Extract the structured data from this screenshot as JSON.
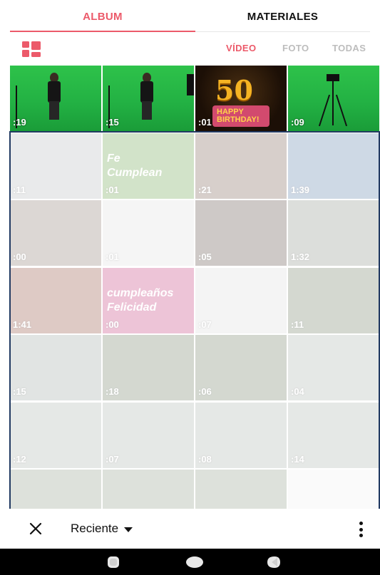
{
  "tabs": {
    "album": "ALBUM",
    "materiales": "MATERIALES",
    "active": "album"
  },
  "filters": {
    "video": "VÍDEO",
    "foto": "FOTO",
    "todas": "TODAS",
    "active": "video"
  },
  "grid": {
    "columns": 4,
    "cells": [
      {
        "duration": ":19",
        "thumb": "greenscreen-man",
        "dimmed": false
      },
      {
        "duration": ":15",
        "thumb": "greenscreen-man-softbox",
        "dimmed": false
      },
      {
        "duration": ":01",
        "thumb": "birthday-50-cake",
        "overlay_text": [
          "50",
          "HAPPY",
          "BIRTHDAY!"
        ],
        "dimmed": false
      },
      {
        "duration": ":09",
        "thumb": "greenscreen-tripod",
        "dimmed": false
      },
      {
        "duration": ":11",
        "thumb": "cable",
        "dimmed": true
      },
      {
        "duration": ":01",
        "thumb": "flowers-card",
        "overlay_text": [
          "Fe",
          "Cumplean"
        ],
        "dimmed": true
      },
      {
        "duration": ":21",
        "thumb": "people-hats",
        "dimmed": true
      },
      {
        "duration": "1:39",
        "thumb": "map",
        "dimmed": true
      },
      {
        "duration": ":00",
        "thumb": "man-portrait",
        "dimmed": true
      },
      {
        "duration": ":01",
        "thumb": "blank-orange",
        "dimmed": true
      },
      {
        "duration": ":05",
        "thumb": "dark-room",
        "dimmed": true
      },
      {
        "duration": "1:32",
        "thumb": "wires",
        "dimmed": true
      },
      {
        "duration": "1:41",
        "thumb": "rope-tools",
        "dimmed": true
      },
      {
        "duration": ":00",
        "thumb": "puppy-card",
        "overlay_text": [
          "cumpleaños",
          "Felicidad"
        ],
        "dimmed": true
      },
      {
        "duration": ":07",
        "thumb": "bee-mascot",
        "dimmed": true
      },
      {
        "duration": ":11",
        "thumb": "crowd-field",
        "dimmed": true
      },
      {
        "duration": ":15",
        "thumb": "room-bench",
        "dimmed": true
      },
      {
        "duration": ":18",
        "thumb": "crowd-field",
        "dimmed": true
      },
      {
        "duration": ":06",
        "thumb": "crowd-field",
        "dimmed": true
      },
      {
        "duration": ":04",
        "thumb": "tents-field",
        "dimmed": true
      },
      {
        "duration": ":12",
        "thumb": "tents-field",
        "dimmed": true
      },
      {
        "duration": ":07",
        "thumb": "tents-field",
        "dimmed": true
      },
      {
        "duration": ":08",
        "thumb": "tents-field",
        "dimmed": true
      },
      {
        "duration": ":14",
        "thumb": "tents-field",
        "dimmed": true
      },
      {
        "duration": "",
        "thumb": "field",
        "dimmed": true
      },
      {
        "duration": "",
        "thumb": "field",
        "dimmed": true
      },
      {
        "duration": "",
        "thumb": "field",
        "dimmed": true
      },
      {
        "duration": "",
        "thumb": "blank",
        "dimmed": true
      }
    ]
  },
  "bottom_bar": {
    "close_icon": "close-icon",
    "sort_label": "Reciente",
    "more_icon": "more-vertical-icon"
  },
  "colors": {
    "accent": "#ec5a6a",
    "selection_frame": "#223a62",
    "text": "#111111",
    "inactive": "#bdbdbd"
  }
}
